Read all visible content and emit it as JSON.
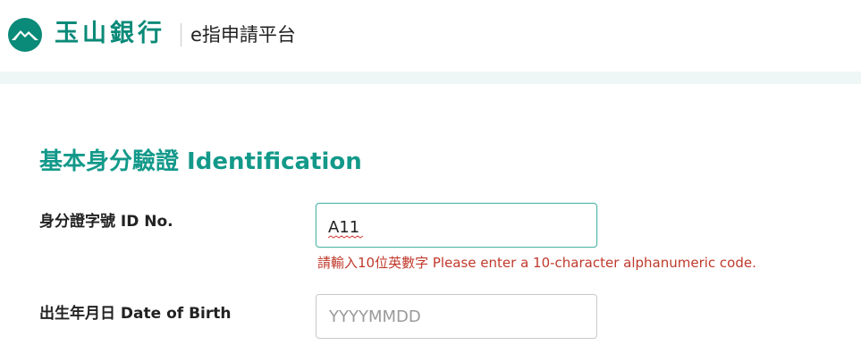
{
  "brand": {
    "logo_text": "玉山銀行",
    "platform_title": "e指申請平台",
    "accent_color": "#0a8a78"
  },
  "section": {
    "title": "基本身分驗證 Identification"
  },
  "fields": {
    "id_no": {
      "label": "身分證字號  ID No.",
      "value": "A11",
      "error": "請輸入10位英數字 Please enter a 10-character alphanumeric code."
    },
    "dob": {
      "label": "出生年月日  Date of Birth",
      "value": "",
      "placeholder": "YYYYMMDD"
    }
  },
  "colors": {
    "section_title": "#13998a",
    "error": "#c0392b",
    "header_band": "#eef6f6"
  }
}
